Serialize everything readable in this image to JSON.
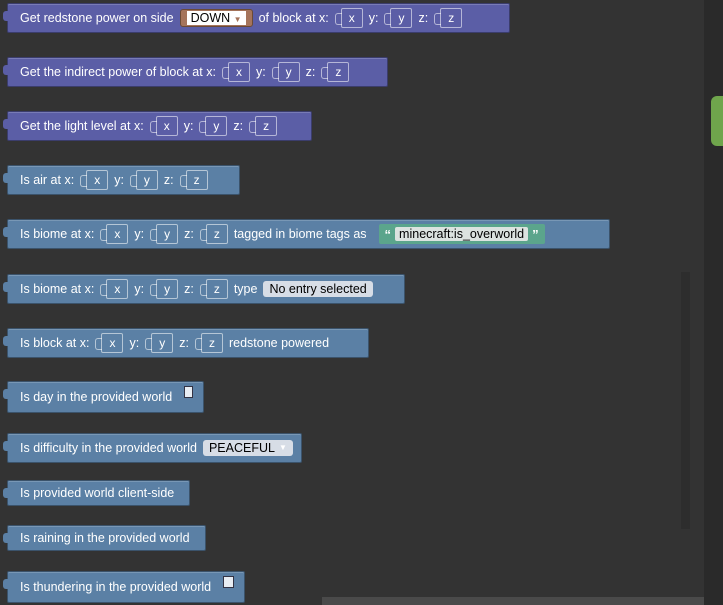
{
  "colors": {
    "workspace_bg": "#333333",
    "world_block": "#5b5ea6",
    "logic_block": "#5b80a5",
    "string_block": "#5ba58c",
    "dropdown_orange": "#a5745b"
  },
  "blocks": [
    {
      "text1": "Get redstone power on side",
      "dropdown": "DOWN",
      "text2": "of block at x:",
      "x": "x",
      "ylab": "y:",
      "y": "y",
      "zlab": "z:",
      "z": "z"
    },
    {
      "text1": "Get the indirect power of block at x:",
      "x": "x",
      "ylab": "y:",
      "y": "y",
      "zlab": "z:",
      "z": "z"
    },
    {
      "text1": "Get the light level at x:",
      "x": "x",
      "ylab": "y:",
      "y": "y",
      "zlab": "z:",
      "z": "z"
    },
    {
      "text1": "Is air at x:",
      "x": "x",
      "ylab": "y:",
      "y": "y",
      "zlab": "z:",
      "z": "z"
    },
    {
      "text1": "Is biome at x:",
      "x": "x",
      "ylab": "y:",
      "y": "y",
      "zlab": "z:",
      "z": "z",
      "text2": "tagged in biome tags as",
      "quote_open": "“",
      "string": "minecraft:is_overworld",
      "quote_close": "”"
    },
    {
      "text1": "Is biome at x:",
      "x": "x",
      "ylab": "y:",
      "y": "y",
      "zlab": "z:",
      "z": "z",
      "text2": "type",
      "dropdown": "No entry selected"
    },
    {
      "text1": "Is block at x:",
      "x": "x",
      "ylab": "y:",
      "y": "y",
      "zlab": "z:",
      "z": "z",
      "text2": "redstone powered"
    },
    {
      "text1": "Is day in the provided world"
    },
    {
      "text1": "Is difficulty in the provided world",
      "dropdown": "PEACEFUL"
    },
    {
      "text1": "Is provided world client-side"
    },
    {
      "text1": "Is raining in the provided world"
    },
    {
      "text1": "Is thundering in the provided world"
    }
  ]
}
